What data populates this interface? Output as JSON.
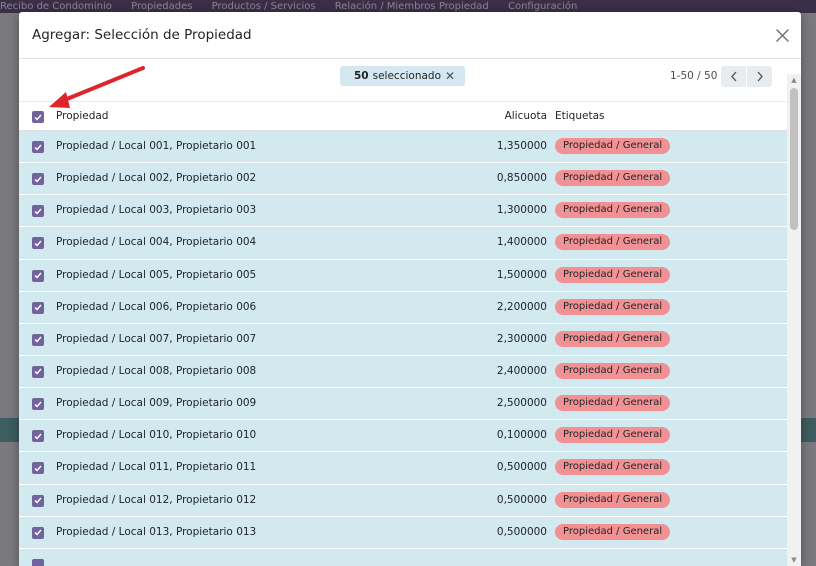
{
  "background": {
    "nav_items": [
      "Recibo de Condominio",
      "Propiedades",
      "Productos / Servicios",
      "Relación / Miembros Propiedad",
      "Configuración"
    ]
  },
  "modal": {
    "title": "Agregar: Selección de Propiedad",
    "selection": {
      "count": "50",
      "label": "seleccionado"
    },
    "pager": {
      "value": "1-50 / 50"
    },
    "columns": {
      "name": "Propiedad",
      "alicuota": "Alicuota",
      "tags": "Etiquetas"
    },
    "rows": [
      {
        "name": "Propiedad / Local 001, Propietario 001",
        "alicuota": "1,350000",
        "tag": "Propiedad / General"
      },
      {
        "name": "Propiedad / Local 002, Propietario 002",
        "alicuota": "0,850000",
        "tag": "Propiedad / General"
      },
      {
        "name": "Propiedad / Local 003, Propietario 003",
        "alicuota": "1,300000",
        "tag": "Propiedad / General"
      },
      {
        "name": "Propiedad / Local 004, Propietario 004",
        "alicuota": "1,400000",
        "tag": "Propiedad / General"
      },
      {
        "name": "Propiedad / Local 005, Propietario 005",
        "alicuota": "1,500000",
        "tag": "Propiedad / General"
      },
      {
        "name": "Propiedad / Local 006, Propietario 006",
        "alicuota": "2,200000",
        "tag": "Propiedad / General"
      },
      {
        "name": "Propiedad / Local 007, Propietario 007",
        "alicuota": "2,300000",
        "tag": "Propiedad / General"
      },
      {
        "name": "Propiedad / Local 008, Propietario 008",
        "alicuota": "2,400000",
        "tag": "Propiedad / General"
      },
      {
        "name": "Propiedad / Local 009, Propietario 009",
        "alicuota": "2,500000",
        "tag": "Propiedad / General"
      },
      {
        "name": "Propiedad / Local 010, Propietario 010",
        "alicuota": "0,100000",
        "tag": "Propiedad / General"
      },
      {
        "name": "Propiedad / Local 011, Propietario 011",
        "alicuota": "0,500000",
        "tag": "Propiedad / General"
      },
      {
        "name": "Propiedad / Local 012, Propietario 012",
        "alicuota": "0,500000",
        "tag": "Propiedad / General"
      },
      {
        "name": "Propiedad / Local 013, Propietario 013",
        "alicuota": "0,500000",
        "tag": "Propiedad / General"
      }
    ]
  },
  "colors": {
    "checkbox": "#71639e",
    "row_selected": "#d1e9ef",
    "tag": "#f29193",
    "arrow": "#e0242c"
  }
}
